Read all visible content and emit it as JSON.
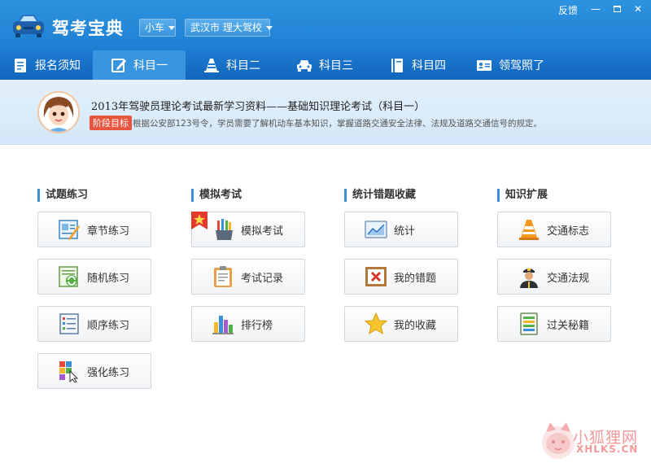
{
  "app": {
    "title": "驾考宝典"
  },
  "header": {
    "vehicle_select": "小车",
    "location_select": "武汉市 理大驾校",
    "feedback": "反馈",
    "minimize": "—",
    "close": "✕"
  },
  "nav": {
    "tabs": [
      {
        "label": "报名须知",
        "icon": "clipboard-icon"
      },
      {
        "label": "科目一",
        "icon": "edit-icon",
        "active": true
      },
      {
        "label": "科目二",
        "icon": "traffic-cone-icon"
      },
      {
        "label": "科目三",
        "icon": "car-icon"
      },
      {
        "label": "科目四",
        "icon": "book-icon"
      },
      {
        "label": "领驾照了",
        "icon": "id-card-icon"
      }
    ]
  },
  "banner": {
    "title": "2013年驾驶员理论考试最新学习资料——基础知识理论考试（科目一）",
    "badge": "阶段目标",
    "description": "根据公安部123号令，学员需要了解机动车基本知识，掌握道路交通安全法律、法规及道路交通信号的规定。"
  },
  "sections": [
    {
      "title": "试题练习",
      "items": [
        "章节练习",
        "随机练习",
        "顺序练习",
        "强化练习"
      ]
    },
    {
      "title": "模拟考试",
      "items": [
        "模拟考试",
        "考试记录",
        "排行榜"
      ]
    },
    {
      "title": "统计错题收藏",
      "items": [
        "统计",
        "我的错题",
        "我的收藏"
      ]
    },
    {
      "title": "知识扩展",
      "items": [
        "交通标志",
        "交通法规",
        "过关秘籍"
      ]
    }
  ],
  "watermark": {
    "name": "小狐狸网",
    "url": "XHLKS.CN"
  },
  "colors": {
    "titlebar": "#2d93df",
    "nav": "#1c7ad0",
    "nav_active": "#3a95e0",
    "badge": "#e9543f",
    "section_bar": "#3a8fd9"
  }
}
